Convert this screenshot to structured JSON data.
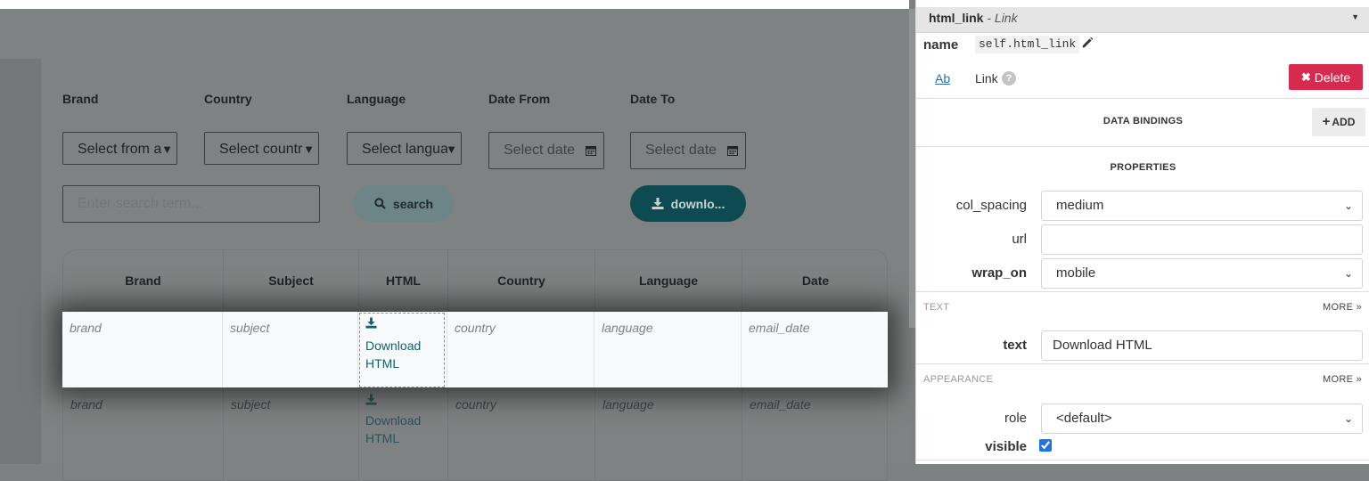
{
  "filters": {
    "brand_label": "Brand",
    "country_label": "Country",
    "language_label": "Language",
    "date_from_label": "Date From",
    "date_to_label": "Date To",
    "brand_value": "Select from a",
    "country_value": "Select countr",
    "language_value": "Select langua",
    "date_from_placeholder": "Select date",
    "date_to_placeholder": "Select date",
    "search_placeholder": "Enter search term...",
    "search_button": "search",
    "download_button": "downlo..."
  },
  "grid": {
    "columns": [
      "Brand",
      "Subject",
      "HTML",
      "Country",
      "Language",
      "Date"
    ],
    "row_template": [
      "brand",
      "subject",
      "",
      "country",
      "language",
      "email_date"
    ],
    "link_text": "Download HTML"
  },
  "panel": {
    "component_name": "html_link",
    "component_type": "- Link",
    "name_label": "name",
    "name_value": "self.html_link",
    "tab_ab": "Ab",
    "tab_link": "Link",
    "delete_button": "Delete",
    "data_bindings_title": "DATA BINDINGS",
    "add_button": "ADD",
    "properties_title": "PROPERTIES",
    "col_spacing_label": "col_spacing",
    "col_spacing_value": "medium",
    "url_label": "url",
    "url_value": "",
    "wrap_on_label": "wrap_on",
    "wrap_on_value": "mobile",
    "text_section": "TEXT",
    "more_label": "MORE",
    "text_label": "text",
    "text_value": "Download HTML",
    "appearance_section": "APPEARANCE",
    "role_label": "role",
    "role_value": "<default>",
    "visible_label": "visible",
    "visible_checked": true
  },
  "colors": {
    "delete": "#d62b4e",
    "link": "#175e6d",
    "download_button": "#0d4a52"
  }
}
